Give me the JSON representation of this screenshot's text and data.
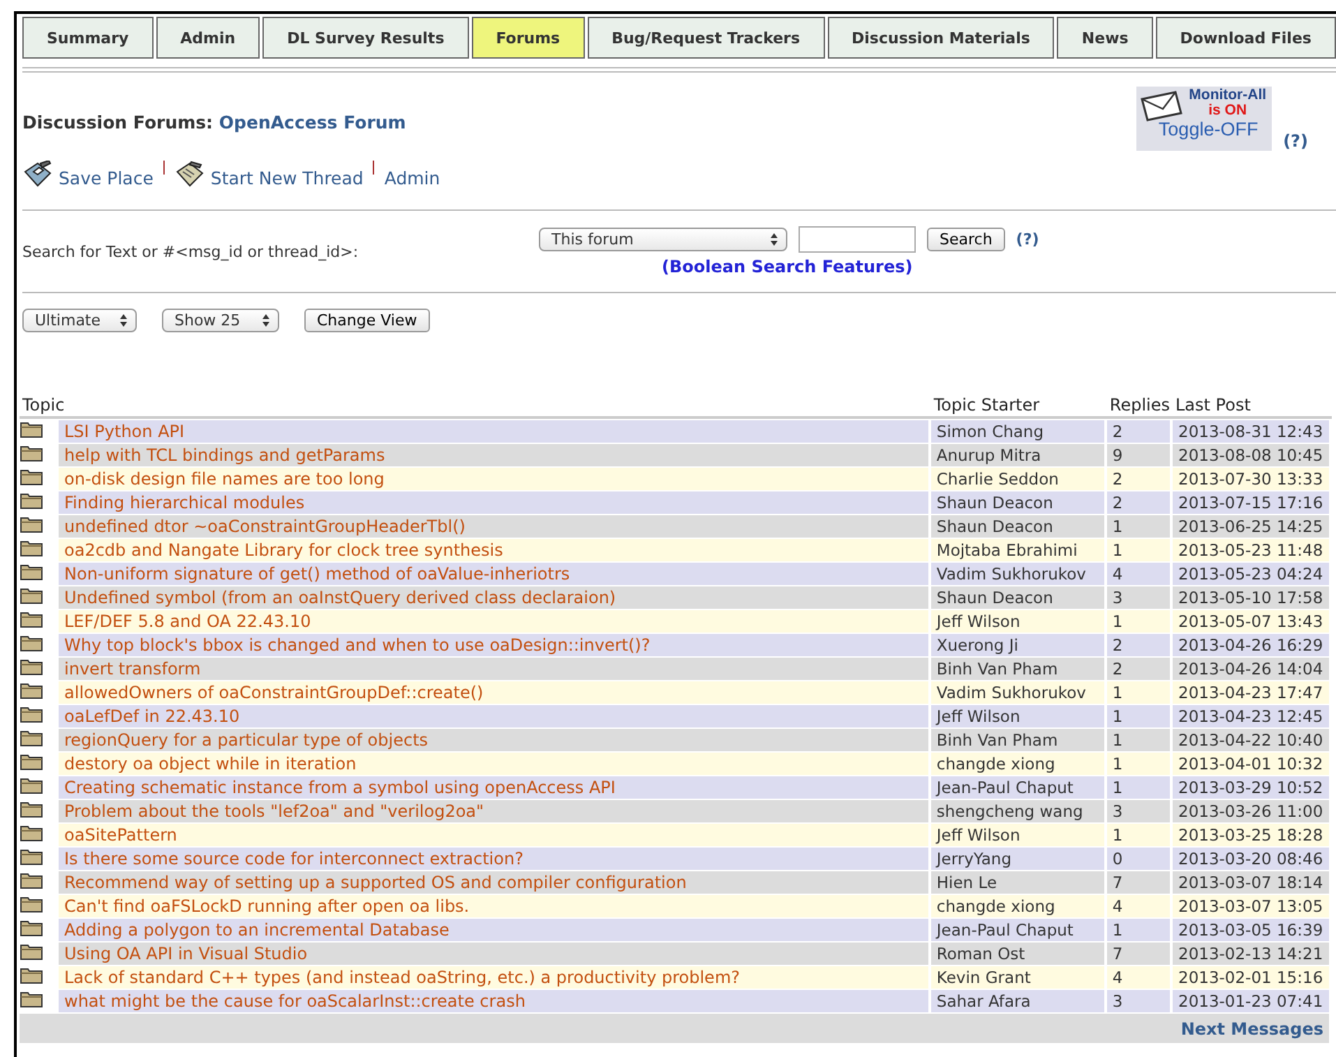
{
  "tabs": [
    {
      "label": "Summary",
      "selected": false
    },
    {
      "label": "Admin",
      "selected": false
    },
    {
      "label": "DL Survey Results",
      "selected": false
    },
    {
      "label": "Forums",
      "selected": true
    },
    {
      "label": "Bug/Request Trackers",
      "selected": false
    },
    {
      "label": "Discussion Materials",
      "selected": false
    },
    {
      "label": "News",
      "selected": false
    },
    {
      "label": "Download Files",
      "selected": false
    }
  ],
  "header": {
    "label": "Discussion Forums:",
    "forum": "OpenAccess Forum"
  },
  "monitor": {
    "title": "Monitor-All",
    "status": "is ON",
    "toggle": "Toggle-OFF",
    "help": "(?)"
  },
  "actions": [
    {
      "label": "Save Place",
      "kind": "save"
    },
    {
      "label": "Start New Thread",
      "kind": "new"
    },
    {
      "label": "Admin",
      "kind": "none"
    }
  ],
  "search": {
    "label": "Search for Text or #<msg_id or thread_id>:",
    "scope": "This forum",
    "button": "Search",
    "help": "(?)",
    "features_link": "(Boolean Search Features)"
  },
  "view": {
    "sort": "Ultimate",
    "show": "Show 25",
    "button": "Change View"
  },
  "table": {
    "columns": [
      "Topic",
      "Topic Starter",
      "Replies",
      "Last Post"
    ],
    "rows": [
      {
        "topic": "LSI Python API",
        "starter": "Simon Chang",
        "replies": "2",
        "last_post": "2013-08-31 12:43"
      },
      {
        "topic": "help with TCL bindings and getParams",
        "starter": "Anurup Mitra",
        "replies": "9",
        "last_post": "2013-08-08 10:45"
      },
      {
        "topic": "on-disk design file names are too long",
        "starter": "Charlie Seddon",
        "replies": "2",
        "last_post": "2013-07-30 13:33"
      },
      {
        "topic": "Finding hierarchical modules",
        "starter": "Shaun Deacon",
        "replies": "2",
        "last_post": "2013-07-15 17:16"
      },
      {
        "topic": "undefined dtor ~oaConstraintGroupHeaderTbl()",
        "starter": "Shaun Deacon",
        "replies": "1",
        "last_post": "2013-06-25 14:25"
      },
      {
        "topic": "oa2cdb and Nangate Library for clock tree synthesis",
        "starter": "Mojtaba Ebrahimi",
        "replies": "1",
        "last_post": "2013-05-23 11:48"
      },
      {
        "topic": "Non-uniform signature of get() method of oaValue-inheriotrs",
        "starter": "Vadim Sukhorukov",
        "replies": "4",
        "last_post": "2013-05-23 04:24"
      },
      {
        "topic": "Undefined symbol (from an oaInstQuery derived class declaraion)",
        "starter": "Shaun Deacon",
        "replies": "3",
        "last_post": "2013-05-10 17:58"
      },
      {
        "topic": "LEF/DEF 5.8 and OA 22.43.10",
        "starter": "Jeff Wilson",
        "replies": "1",
        "last_post": "2013-05-07 13:43"
      },
      {
        "topic": "Why top block's bbox is changed and when to use oaDesign::invert()?",
        "starter": "Xuerong Ji",
        "replies": "2",
        "last_post": "2013-04-26 16:29"
      },
      {
        "topic": "invert transform",
        "starter": "Binh Van Pham",
        "replies": "2",
        "last_post": "2013-04-26 14:04"
      },
      {
        "topic": "allowedOwners of oaConstraintGroupDef::create()",
        "starter": "Vadim Sukhorukov",
        "replies": "1",
        "last_post": "2013-04-23 17:47"
      },
      {
        "topic": "oaLefDef in 22.43.10",
        "starter": "Jeff Wilson",
        "replies": "1",
        "last_post": "2013-04-23 12:45"
      },
      {
        "topic": "regionQuery for a particular type of objects",
        "starter": "Binh Van Pham",
        "replies": "1",
        "last_post": "2013-04-22 10:40"
      },
      {
        "topic": "destory oa object while in iteration",
        "starter": "changde xiong",
        "replies": "1",
        "last_post": "2013-04-01 10:32"
      },
      {
        "topic": "Creating schematic instance from a symbol using openAccess API",
        "starter": "Jean-Paul Chaput",
        "replies": "1",
        "last_post": "2013-03-29 10:52"
      },
      {
        "topic": "Problem about the tools \"lef2oa\" and \"verilog2oa\"",
        "starter": "shengcheng wang",
        "replies": "3",
        "last_post": "2013-03-26 11:00"
      },
      {
        "topic": "oaSitePattern",
        "starter": "Jeff Wilson",
        "replies": "1",
        "last_post": "2013-03-25 18:28"
      },
      {
        "topic": "Is there some source code for interconnect extraction?",
        "starter": "JerryYang",
        "replies": "0",
        "last_post": "2013-03-20 08:46"
      },
      {
        "topic": "Recommend way of setting up a supported OS and compiler configuration",
        "starter": "Hien Le",
        "replies": "7",
        "last_post": "2013-03-07 18:14"
      },
      {
        "topic": "Can't find oaFSLockD running after open oa libs.",
        "starter": "changde xiong",
        "replies": "4",
        "last_post": "2013-03-07 13:05"
      },
      {
        "topic": "Adding a polygon to an incremental Database",
        "starter": "Jean-Paul Chaput",
        "replies": "1",
        "last_post": "2013-03-05 16:39"
      },
      {
        "topic": "Using OA API in Visual Studio",
        "starter": "Roman Ost",
        "replies": "7",
        "last_post": "2013-02-13 14:21"
      },
      {
        "topic": "Lack of standard C++ types (and instead oaString, etc.) a productivity problem?",
        "starter": "Kevin Grant",
        "replies": "4",
        "last_post": "2013-02-01 15:16"
      },
      {
        "topic": "what might be the cause for oaScalarInst::create crash",
        "starter": "Sahar Afara",
        "replies": "3",
        "last_post": "2013-01-23 07:41"
      }
    ],
    "next_link": "Next Messages"
  }
}
